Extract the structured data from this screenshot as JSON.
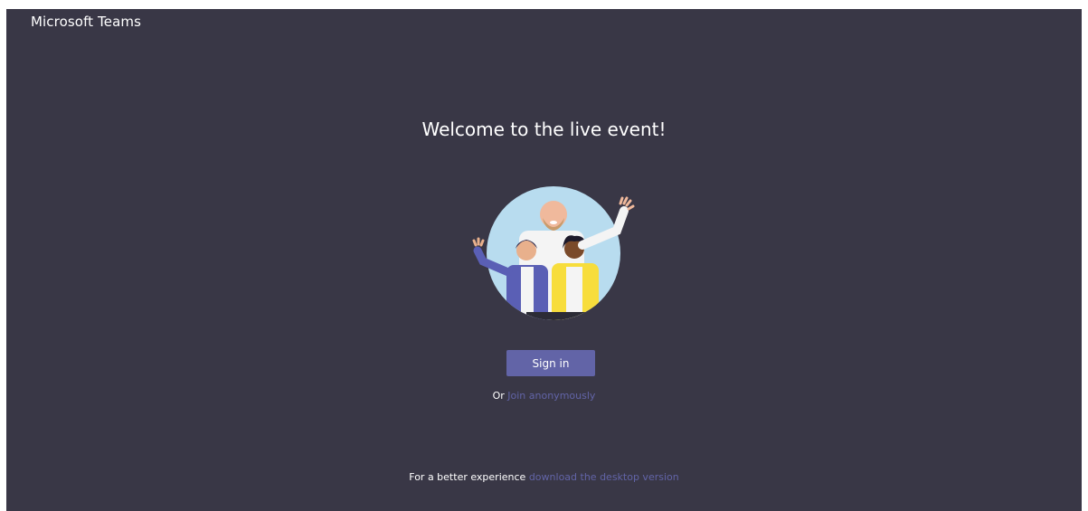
{
  "app": {
    "title": "Microsoft Teams",
    "background": "#393746",
    "accent": "#6264a7"
  },
  "main": {
    "heading": "Welcome to the live event!",
    "illustration_icon": "people-waving-illustration",
    "sign_in_label": "Sign in",
    "alt_prefix": "Or",
    "join_anon_label": "Join anonymously"
  },
  "footer": {
    "prefix": "For a better experience",
    "download_link_label": "download the desktop version"
  }
}
